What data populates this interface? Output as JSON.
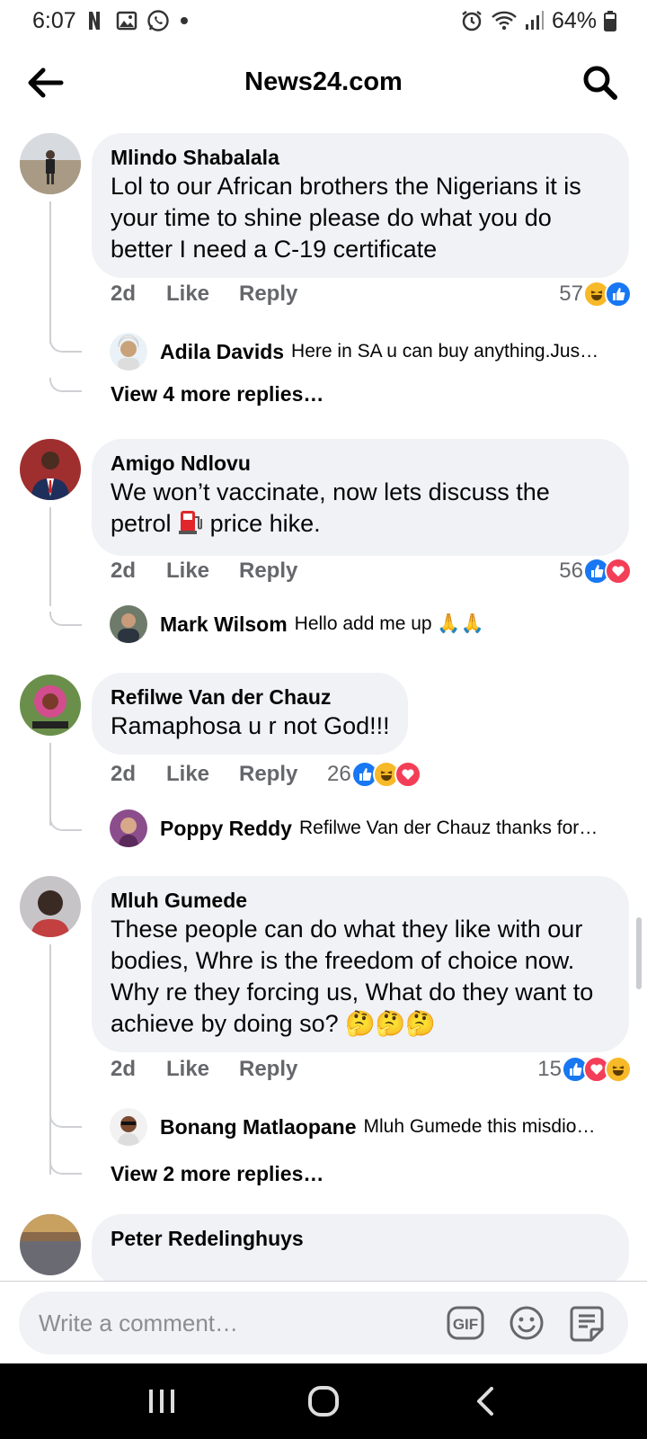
{
  "status_bar": {
    "time": "6:07",
    "battery": "64%"
  },
  "header": {
    "title": "News24.com"
  },
  "threads": [
    {
      "author": "Mlindo Shabalala",
      "text": "Lol to our African brothers the Nigerians it is your time to shine please do what you do better I need a C-19 certificate",
      "time": "2d",
      "like_label": "Like",
      "reply_label": "Reply",
      "reaction_count": "57",
      "reply": {
        "author": "Adila Davids",
        "text": "Here in SA u can buy anything.Jus…"
      },
      "more_replies": "View 4 more replies…"
    },
    {
      "author": "Amigo Ndlovu",
      "text_before": "We won’t vaccinate, now lets discuss the petrol",
      "text_after": "price hike.",
      "time": "2d",
      "like_label": "Like",
      "reply_label": "Reply",
      "reaction_count": "56",
      "reply": {
        "author": "Mark Wilsom",
        "text": "Hello add me up 🙏🙏"
      }
    },
    {
      "author": "Refilwe Van der Chauz",
      "text": "Ramaphosa u r not God!!!",
      "time": "2d",
      "like_label": "Like",
      "reply_label": "Reply",
      "reaction_count": "26",
      "reply": {
        "author": "Poppy Reddy",
        "text": "Refilwe Van der Chauz thanks for…"
      }
    },
    {
      "author": "Mluh Gumede",
      "text": "These people can do what they like with our bodies, Whre is the freedom of choice now. Why re they forcing us, What do they want to achieve by doing so? 🤔🤔🤔",
      "time": "2d",
      "like_label": "Like",
      "reply_label": "Reply",
      "reaction_count": "15",
      "reply": {
        "author": "Bonang Matlaopane",
        "text": "Mluh Gumede this misdio…"
      },
      "more_replies": "View 2 more replies…"
    },
    {
      "author": "Peter Redelinghuys"
    }
  ],
  "composer": {
    "placeholder": "Write a comment…"
  },
  "colors": {
    "bubble": "#f0f2f5",
    "like": "#1877f2",
    "love": "#f33e58",
    "haha": "#f7b928",
    "meta_text": "#65676b"
  },
  "icons": [
    "back-arrow-icon",
    "search-icon",
    "gif-icon",
    "emoji-icon",
    "sticker-icon",
    "recents-icon",
    "home-icon",
    "back-icon"
  ]
}
